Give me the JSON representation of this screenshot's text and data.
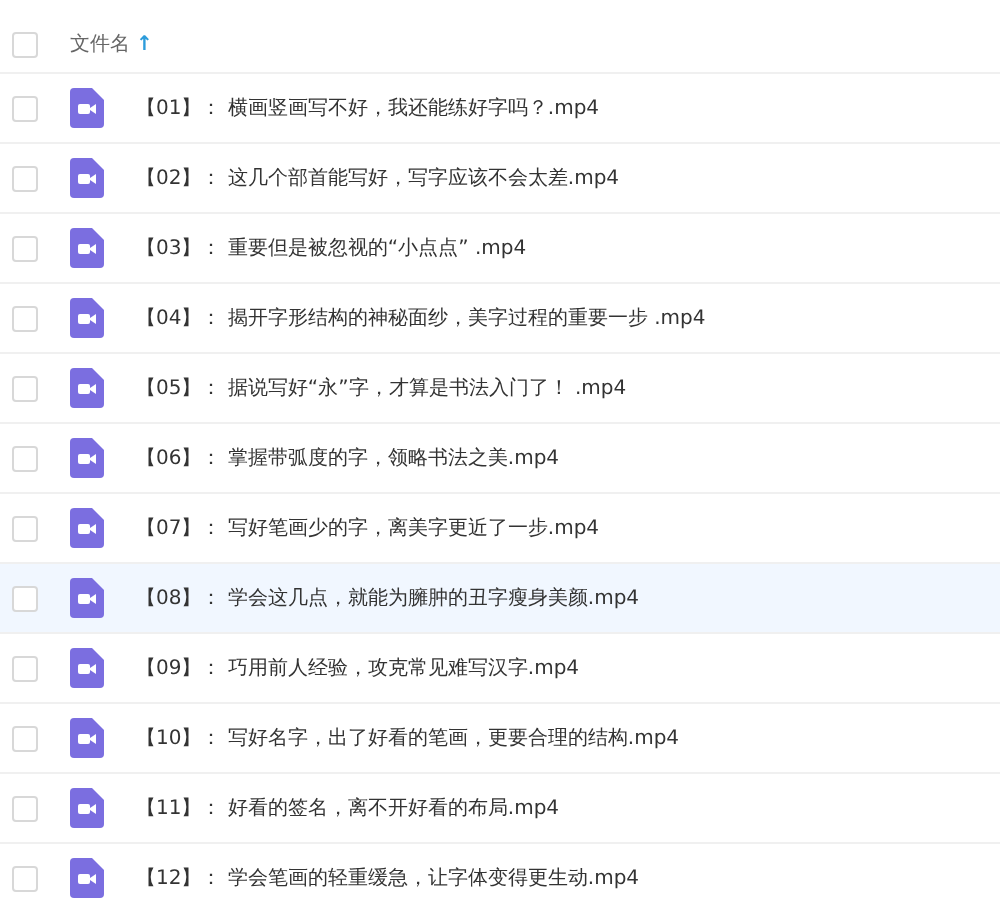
{
  "table": {
    "header": {
      "label": "文件名",
      "sort_arrow": "↑",
      "checked": false
    },
    "rows": [
      {
        "name": "【01】： 横画竖画写不好，我还能练好字吗？.mp4",
        "checked": false,
        "selected": false
      },
      {
        "name": "【02】： 这几个部首能写好，写字应该不会太差.mp4",
        "checked": false,
        "selected": false
      },
      {
        "name": "【03】： 重要但是被忽视的“小点点” .mp4",
        "checked": false,
        "selected": false
      },
      {
        "name": "【04】： 揭开字形结构的神秘面纱，美字过程的重要一步 .mp4",
        "checked": false,
        "selected": false
      },
      {
        "name": "【05】： 据说写好“永”字，才算是书法入门了！ .mp4",
        "checked": false,
        "selected": false
      },
      {
        "name": "【06】： 掌握带弧度的字，领略书法之美.mp4",
        "checked": false,
        "selected": false
      },
      {
        "name": "【07】： 写好笔画少的字，离美字更近了一步.mp4",
        "checked": false,
        "selected": false
      },
      {
        "name": "【08】： 学会这几点，就能为臃肿的丑字瘦身美颜.mp4",
        "checked": false,
        "selected": true
      },
      {
        "name": "【09】： 巧用前人经验，攻克常见难写汉字.mp4",
        "checked": false,
        "selected": false
      },
      {
        "name": "【10】： 写好名字，出了好看的笔画，更要合理的结构.mp4",
        "checked": false,
        "selected": false
      },
      {
        "name": "【11】： 好看的签名，离不开好看的布局.mp4",
        "checked": false,
        "selected": false
      },
      {
        "name": "【12】： 学会笔画的轻重缓急，让字体变得更生动.mp4",
        "checked": false,
        "selected": false
      }
    ]
  }
}
